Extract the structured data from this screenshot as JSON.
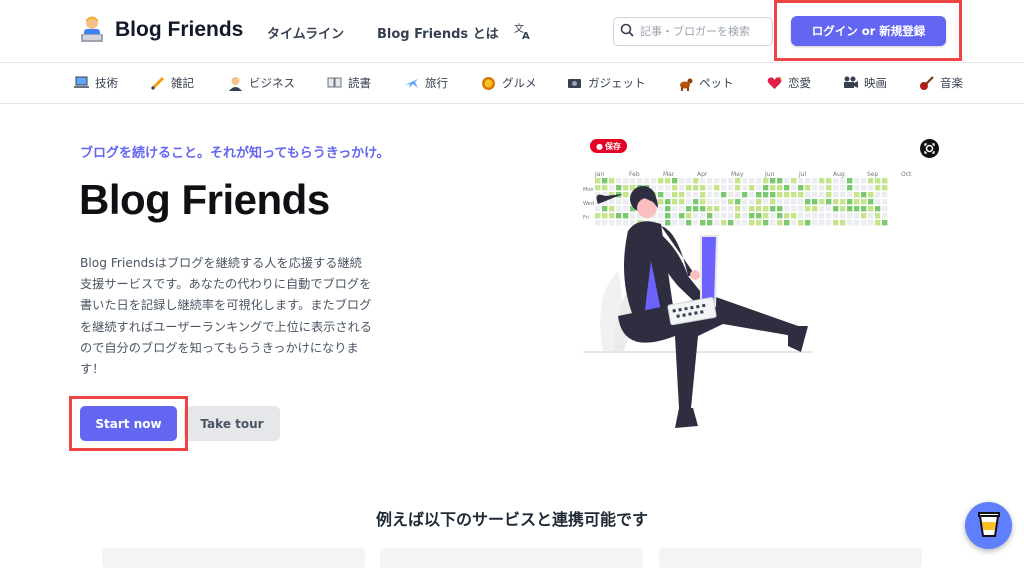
{
  "header": {
    "brand": "Blog Friends",
    "nav": [
      {
        "label": "タイムライン"
      },
      {
        "label": "Blog Friends とは"
      }
    ],
    "search_placeholder": "記事・ブロガーを検索",
    "login_label": "ログイン or 新規登録"
  },
  "categories": [
    {
      "label": "技術",
      "icon": "laptop-icon"
    },
    {
      "label": "雑記",
      "icon": "pencil-icon"
    },
    {
      "label": "ビジネス",
      "icon": "businessperson-icon"
    },
    {
      "label": "読書",
      "icon": "book-icon"
    },
    {
      "label": "旅行",
      "icon": "airplane-icon"
    },
    {
      "label": "グルメ",
      "icon": "cookie-icon"
    },
    {
      "label": "ガジェット",
      "icon": "camera-icon"
    },
    {
      "label": "ペット",
      "icon": "dog-icon"
    },
    {
      "label": "恋愛",
      "icon": "heart-icon"
    },
    {
      "label": "映画",
      "icon": "movie-camera-icon"
    },
    {
      "label": "音楽",
      "icon": "guitar-icon"
    }
  ],
  "hero": {
    "tagline": "ブログを続けること。それが知ってもらうきっかけ。",
    "title": "Blog Friends",
    "description": "Blog Friendsはブログを継続する人を応援する継続支援サービスです。あなたの代わりに自動でブログを書いた日を記録し継続率を可視化します。またブログを継続すればユーザーランキングで上位に表示されるので自分のブログを知ってもらうきっかけになります！",
    "start_label": "Start now",
    "tour_label": "Take tour"
  },
  "illustration": {
    "pin_save_label": "保存",
    "months": [
      "Jan",
      "Feb",
      "Mar",
      "Apr",
      "May",
      "Jun",
      "Jul",
      "Aug",
      "Sep",
      "Oct"
    ],
    "days": [
      "Mon",
      "Wed",
      "Fri"
    ]
  },
  "services": {
    "title": "例えば以下のサービスと連携可能です"
  },
  "colors": {
    "accent": "#6366f1",
    "highlight": "#ef4444",
    "grass_light": "#c6e48b",
    "grass_dark": "#7bc96f",
    "figure": "#2f2e41"
  }
}
